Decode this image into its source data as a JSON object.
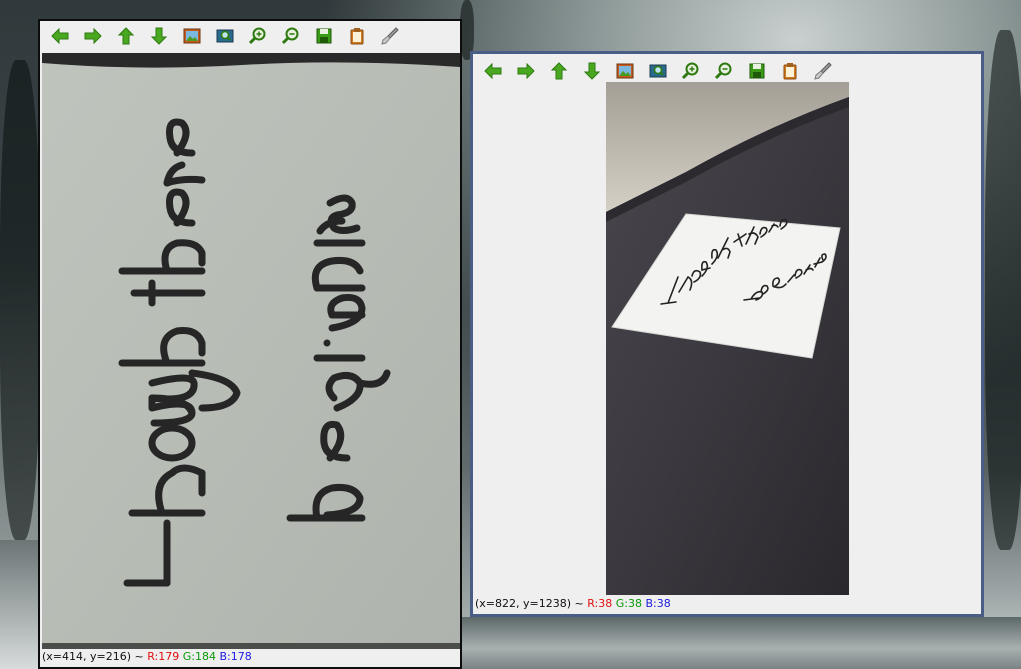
{
  "desktop": {
    "wallpaper": "snowy-winter-forest"
  },
  "toolbar_icons": [
    {
      "name": "back-arrow-icon",
      "color": "#3a9a14"
    },
    {
      "name": "forward-arrow-icon",
      "color": "#3a9a14"
    },
    {
      "name": "up-arrow-icon",
      "color": "#3a9a14"
    },
    {
      "name": "down-arrow-icon",
      "color": "#3a9a14"
    },
    {
      "name": "image-icon",
      "color": "#6a8f2a"
    },
    {
      "name": "zoom-fit-icon",
      "color": "#3a7a14"
    },
    {
      "name": "zoom-in-icon",
      "color": "#3a7a14"
    },
    {
      "name": "zoom-out-icon",
      "color": "#3a7a14"
    },
    {
      "name": "save-icon",
      "color": "#3a8a14"
    },
    {
      "name": "clipboard-icon",
      "color": "#d07a20"
    },
    {
      "name": "brush-icon",
      "color": "#8a8a8a"
    }
  ],
  "window1": {
    "image_text": "Though there be giants",
    "status": {
      "coords": "(x=414, y=216) ~ ",
      "r": "R:179",
      "g": "G:184",
      "b": "B:178"
    }
  },
  "window2": {
    "image_text": "Though there be giants",
    "status": {
      "coords": "(x=822, y=1238) ~ ",
      "r": "R:38",
      "g": "G:38",
      "b": "B:38"
    }
  }
}
